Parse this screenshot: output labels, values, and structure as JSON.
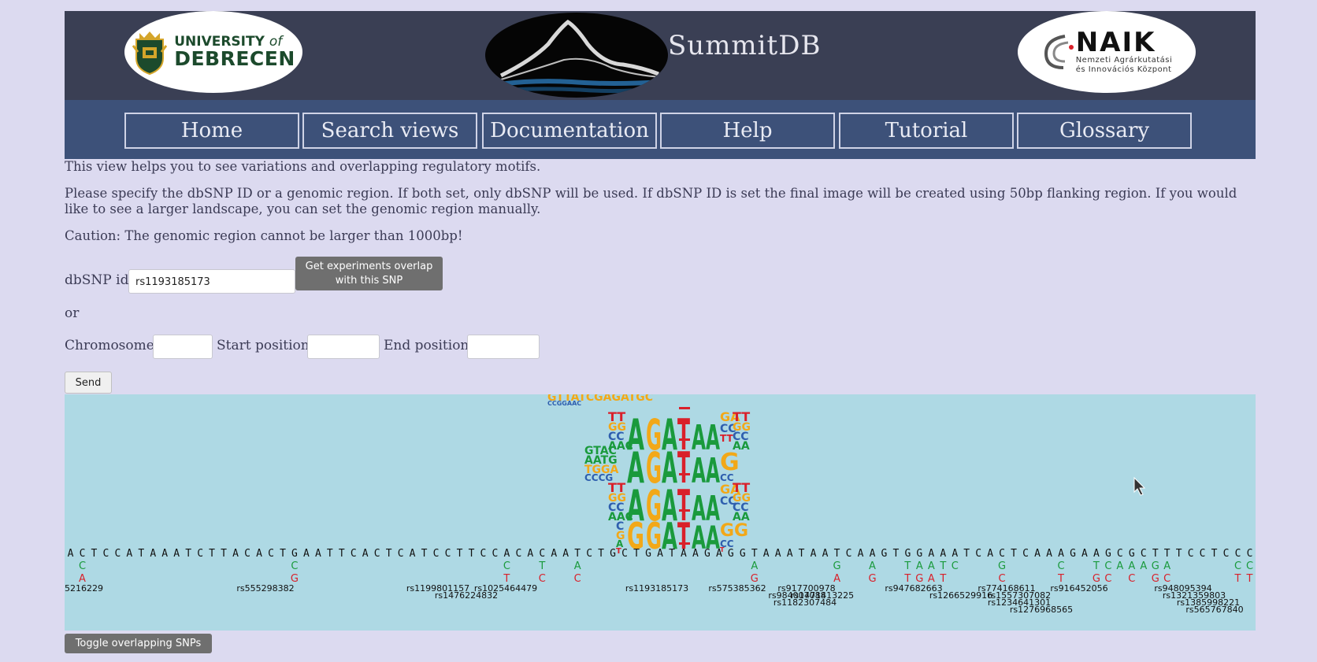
{
  "header": {
    "left_logo": {
      "line1_prefix": "UNIVERSITY",
      "line1_suffix": "of",
      "line2": "DEBRECEN"
    },
    "center_logo": {
      "title": "SummitDB"
    },
    "right_logo": {
      "name": "NAIK",
      "line1": "Nemzeti Agrárkutatási",
      "line2": "és Innovációs Központ"
    }
  },
  "nav": {
    "items": [
      {
        "label": "Home"
      },
      {
        "label": "Search views"
      },
      {
        "label": "Documentation"
      },
      {
        "label": "Help"
      },
      {
        "label": "Tutorial"
      },
      {
        "label": "Glossary"
      }
    ]
  },
  "intro": {
    "p1": "This view helps you to see variations and overlapping regulatory motifs.",
    "p2": "Please specify the dbSNP ID or a genomic region. If both set, only dbSNP will be used. If dbSNP ID is set the final image will be created using 50bp flanking region. If you would like to see a larger landscape, you can set the genomic region manually.",
    "p3": "Caution: The genomic region cannot be larger than 1000bp!"
  },
  "form": {
    "dbsnp_label": "dbSNP id:",
    "dbsnp_value": "rs1193185173",
    "overlap_button_line1": "Get experiments overlap",
    "overlap_button_line2": "with this SNP",
    "or_label": "or",
    "chromosome_label": "Chromosome:",
    "start_label": "Start position:",
    "end_label": "End position:",
    "chromosome_value": "",
    "start_value": "",
    "end_value": "",
    "send_label": "Send"
  },
  "visualization": {
    "sequence": "ACTCCATAAATCTTACACTGAATTCACTCATCCTTCCACACAATCTGCTGATAAGAGGTAAATAATCAAGTGGAAATCACTCAAAGAAGCGCTTTCCTCCC",
    "snp_labels": [
      "5216229",
      "rs555298382",
      "rs1199801157",
      "rs1025464479",
      "rs1476224832",
      "rs1193185173",
      "rs575385362",
      "rs917700978",
      "rs984007088",
      "rs1471413225",
      "rs1182307484",
      "rs947682663",
      "rs1266529916",
      "rs774168611",
      "rs1557307082",
      "rs916452056",
      "rs1234641301",
      "rs1276968565",
      "rs948095394",
      "rs1321359803",
      "rs1385998221",
      "rs565767840"
    ],
    "colors": {
      "A": "#1a9a3c",
      "C": "#2f5fae",
      "G": "#f2a818",
      "T": "#d9202a",
      "alt_green": "#1a9a3c",
      "ref_red": "#d9202a"
    },
    "toggle_label": "Toggle overlapping SNPs"
  }
}
